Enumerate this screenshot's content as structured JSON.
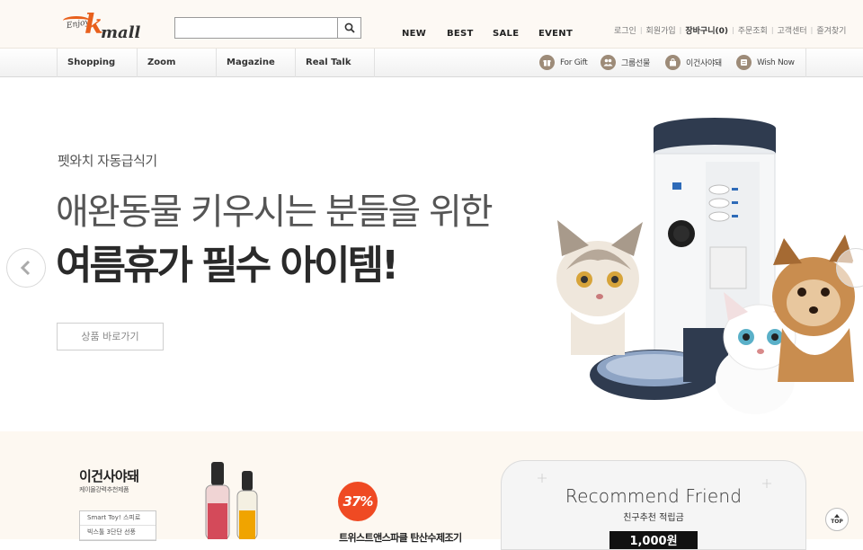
{
  "header": {
    "logo": {
      "enjoy": "Enjoy",
      "k": "k",
      "mall": "mall"
    },
    "search": {
      "placeholder": "",
      "value": ""
    },
    "main_nav": [
      "NEW",
      "BEST",
      "SALE",
      "EVENT"
    ],
    "util_nav": [
      "로그인",
      "회원가입",
      "장바구니(0)",
      "주문조회",
      "고객센터",
      "즐겨찾기"
    ]
  },
  "category_bar": {
    "categories": [
      "Shopping",
      "Zoom",
      "Magazine",
      "Real Talk"
    ],
    "quick_links": [
      {
        "label": "For Gift",
        "icon": "gift-icon"
      },
      {
        "label": "그룹선물",
        "icon": "group-icon"
      },
      {
        "label": "이건사야돼",
        "icon": "bag-icon"
      },
      {
        "label": "Wish Now",
        "icon": "wish-icon"
      }
    ]
  },
  "hero": {
    "subtitle": "펫와치 자동급식기",
    "line1": "애완동물 키우시는 분들을 위한",
    "line2": "여름휴가 필수 아이템!",
    "button": "상품 바로가기"
  },
  "promo": {
    "title": "이건사야돼",
    "desc": "케이몰강력추천제품",
    "list": [
      "Smart Toy! 스피로",
      "빅스툴 3단단 선풍"
    ],
    "badge": "37%",
    "product_name": "트위스트앤스파클 탄산수제조기"
  },
  "recommend": {
    "title": "Recommend Friend",
    "sub": "친구추천 적립금",
    "amount": "1,000원"
  },
  "top_button": "TOP",
  "colors": {
    "accent": "#e8601c",
    "badge": "#ef4a23",
    "header_bg": "#fdf9f4"
  }
}
